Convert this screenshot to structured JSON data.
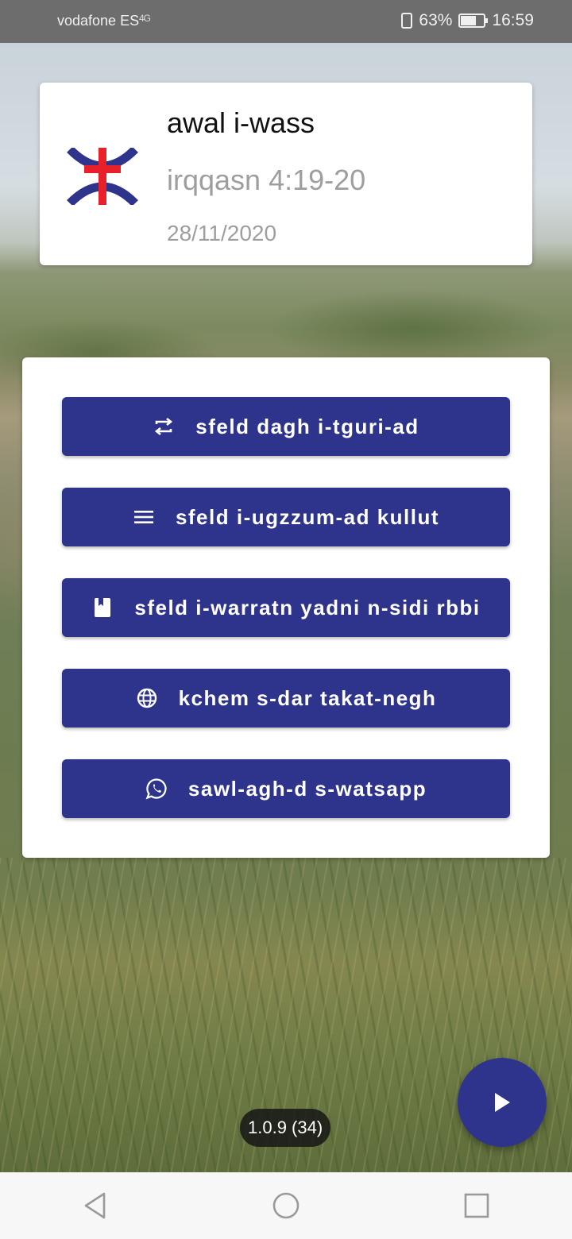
{
  "status_bar": {
    "carrier": "vodafone ES",
    "network": "4G",
    "battery": "63%",
    "time": "16:59"
  },
  "verse": {
    "title": "awal i-wass",
    "reference": "irqqasn 4:19-20",
    "date": "28/11/2020"
  },
  "menu": {
    "buttons": [
      {
        "label": "sfeld dagh i-tguri-ad",
        "icon": "repeat-icon"
      },
      {
        "label": "sfeld i-ugzzum-ad kullut",
        "icon": "menu-lines-icon"
      },
      {
        "label": "sfeld i-warratn yadni n-sidi rbbi",
        "icon": "book-icon"
      },
      {
        "label": "kchem s-dar takat-negh",
        "icon": "globe-icon"
      },
      {
        "label": "sawl-agh-d s-watsapp",
        "icon": "whatsapp-icon"
      }
    ]
  },
  "version": "1.0.9 (34)",
  "colors": {
    "primary": "#2e348b",
    "logo_blue": "#2e348b",
    "logo_red": "#e8202a"
  }
}
